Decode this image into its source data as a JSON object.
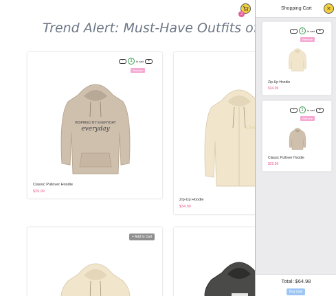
{
  "page": {
    "title": "Trend Alert: Must-Have Outfits of the"
  },
  "header": {
    "cart_count": "2"
  },
  "products": [
    {
      "name": "Classic Pullover Hoodie",
      "price": "$29.99",
      "quantity": "1",
      "in_cart_label": "in cart",
      "remove_label": "Remove",
      "minus_label": "-",
      "plus_label": "+"
    },
    {
      "name": "Zip-Up Hoodie",
      "price": "$34.99"
    },
    {
      "add_label": "+ Add to Cart"
    },
    {}
  ],
  "cart": {
    "title": "Shopping Cart",
    "items": [
      {
        "name": "Zip-Up Hoodie",
        "price": "$34.99",
        "quantity": "1",
        "in_cart_label": "in cart",
        "remove_label": "Remove",
        "minus_label": "-",
        "plus_label": "+"
      },
      {
        "name": "Classic Pullover Hoodie",
        "price": "$29.99",
        "quantity": "1",
        "in_cart_label": "in cart",
        "remove_label": "Remove",
        "minus_label": "-",
        "plus_label": "+"
      }
    ],
    "total": "Total: $64.98",
    "buy_label": "Buy now",
    "close_icon": "close-icon"
  },
  "colors": {
    "accent": "#f4d03f",
    "price": "#e8558e",
    "remove": "#f5a8d2",
    "buy": "#9ec6f3",
    "qty_ring": "#2e9e44"
  },
  "icons": {
    "cart": "cart-icon",
    "close": "close-icon"
  }
}
